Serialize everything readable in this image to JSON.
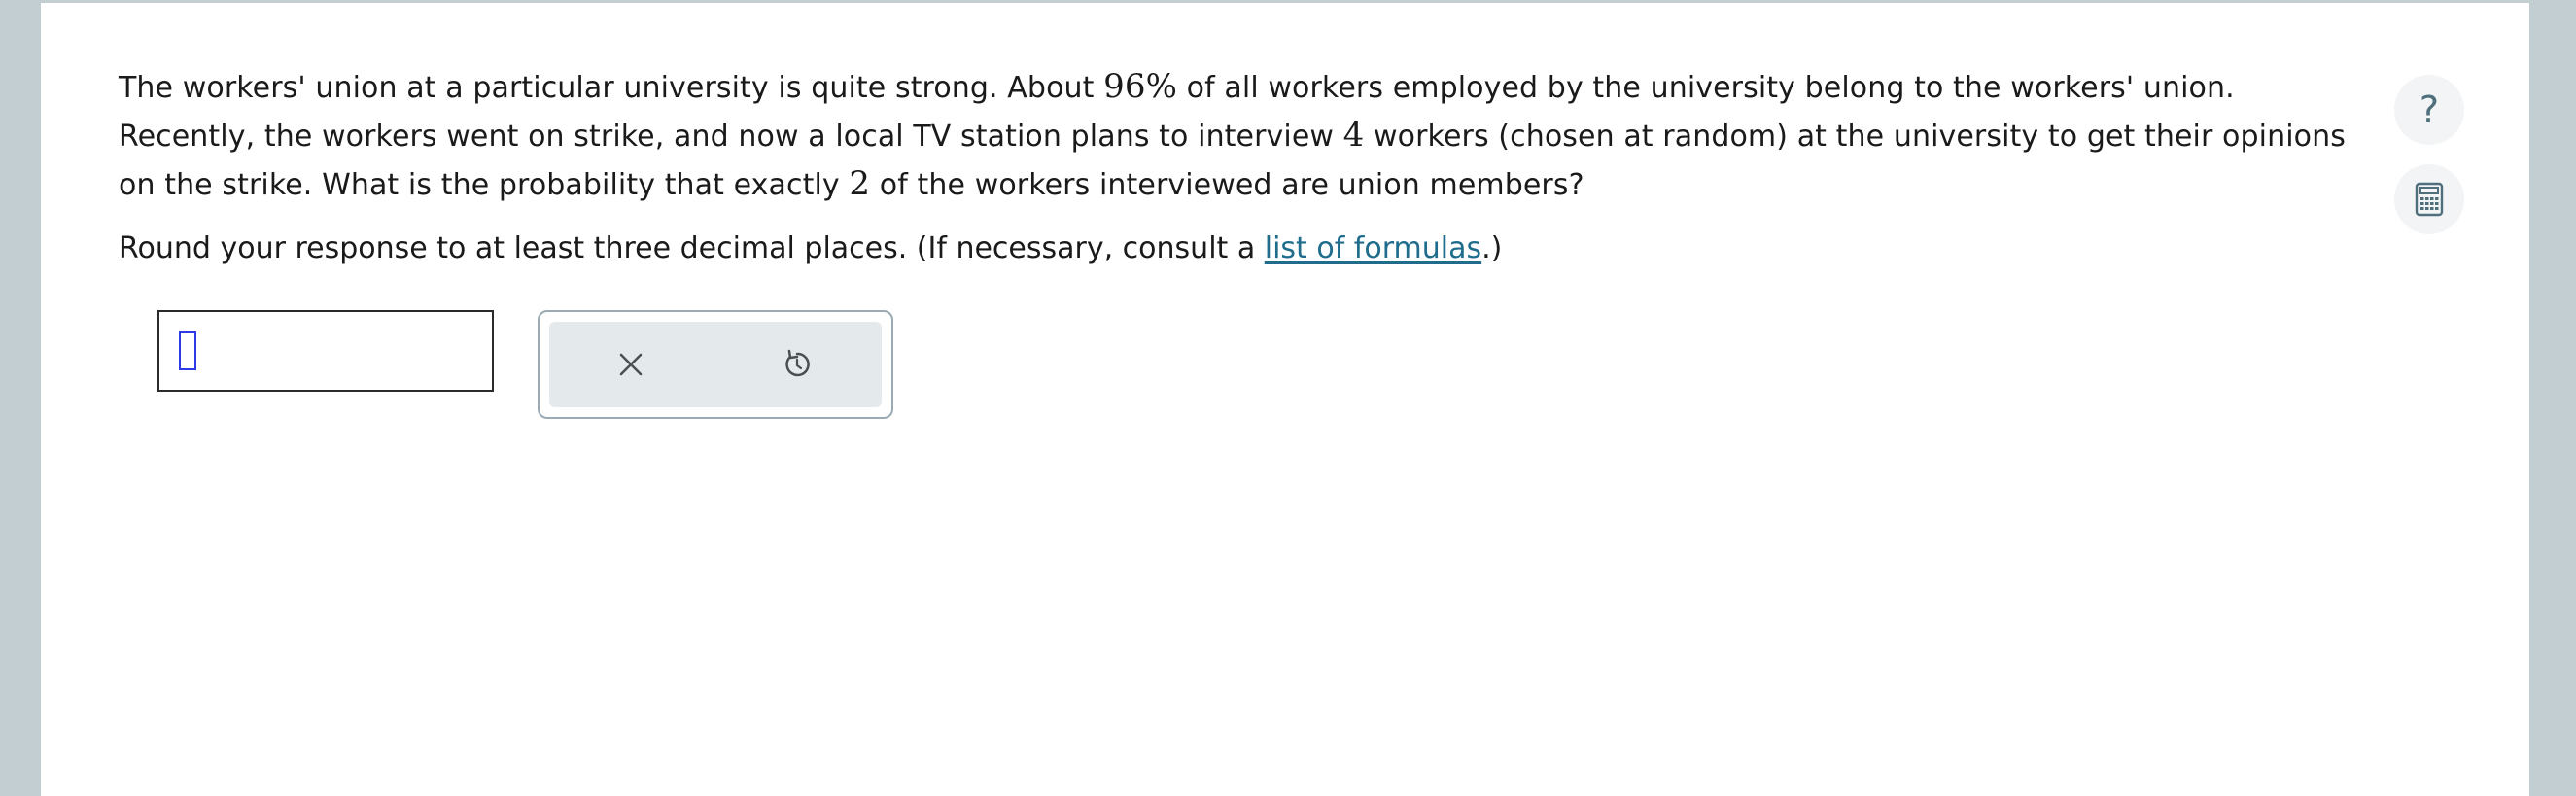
{
  "question": {
    "text_1": "The workers' union at a particular university is quite strong. About ",
    "percent": "96%",
    "text_2": " of all workers employed by the university belong to the workers' union. Recently, the workers went on strike, and now a local TV station plans to interview ",
    "count": "4",
    "text_3": " workers (chosen at random) at the university to get their opinions on the strike. What is the probability that exactly ",
    "exact": "2",
    "text_4": " of the workers interviewed are union members?"
  },
  "instruction": {
    "text_before": "Round your response to at least three decimal places. (If necessary, consult a ",
    "link": "list of formulas",
    "text_after": ".)"
  },
  "answer": {
    "value": ""
  },
  "tools": {
    "clear_icon": "close-icon",
    "undo_icon": "undo-icon"
  },
  "side": {
    "help_label": "?",
    "calculator_icon": "calculator-icon"
  },
  "colors": {
    "background": "#c3ced3",
    "link": "#1f6c8d",
    "caret": "#2e39e8",
    "tool_bg": "#e4e9eb"
  }
}
